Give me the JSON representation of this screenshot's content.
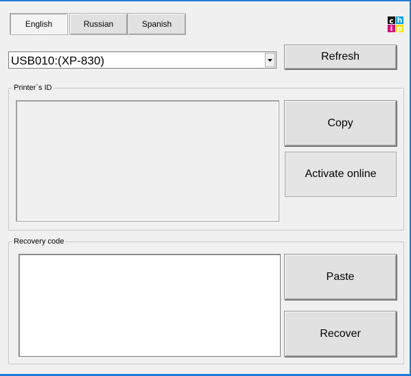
{
  "language_tabs": [
    "English",
    "Russian",
    "Spanish"
  ],
  "logo": {
    "letters": [
      "c",
      "h",
      "i",
      "p"
    ],
    "colors": [
      "#111111",
      "#00a3e0",
      "#e6007e",
      "#ffe600"
    ]
  },
  "printer_select": {
    "value": "USB010:(XP-830)"
  },
  "refresh_label": "Refresh",
  "printer_id": {
    "group_label": "Printer`s ID",
    "value": "",
    "copy_label": "Copy",
    "activate_label": "Activate online"
  },
  "recovery": {
    "group_label": "Recovery code",
    "value": "",
    "paste_label": "Paste",
    "recover_label": "Recover"
  },
  "accent_color": "#1f7bd6"
}
